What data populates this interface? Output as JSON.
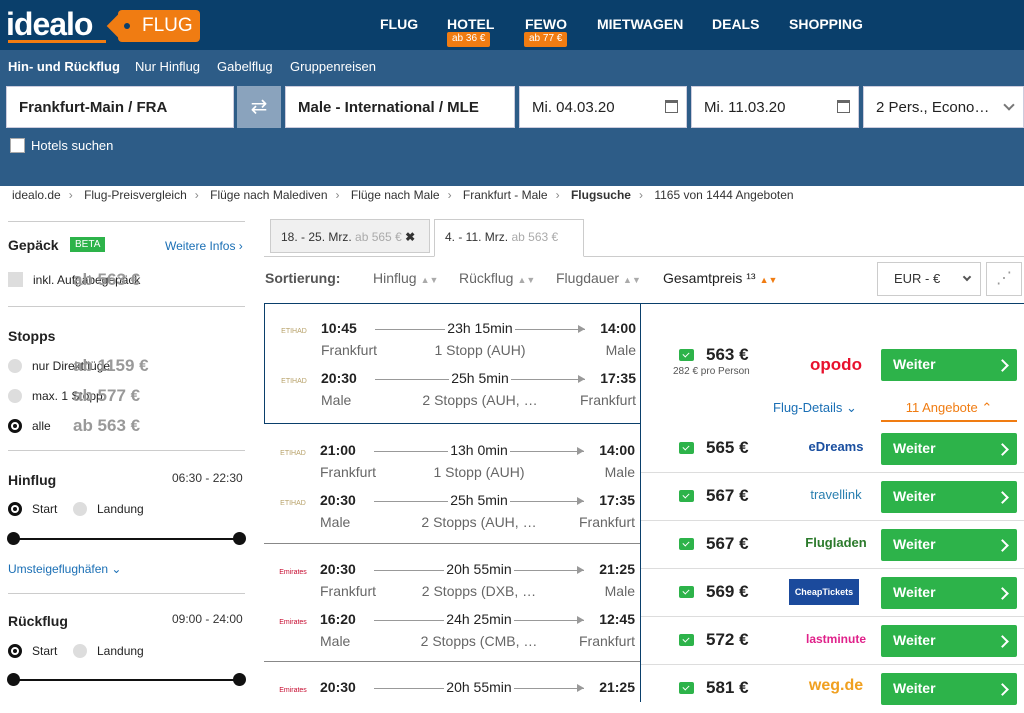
{
  "header": {
    "logo": "idealo",
    "logo_badge": "FLUG",
    "nav": [
      {
        "label": "FLUG"
      },
      {
        "label": "HOTEL",
        "badge": "ab 36 €"
      },
      {
        "label": "FEWO",
        "badge": "ab 77 €"
      },
      {
        "label": "MIETWAGEN"
      },
      {
        "label": "DEALS"
      },
      {
        "label": "SHOPPING"
      }
    ]
  },
  "search": {
    "tabs": [
      "Hin- und Rückflug",
      "Nur Hinflug",
      "Gabelflug",
      "Gruppenreisen"
    ],
    "from": "Frankfurt-Main / FRA",
    "to": "Male - International / MLE",
    "depart": "Mi. 04.03.20",
    "return": "Mi. 11.03.20",
    "passengers": "2 Pers., Econo…",
    "hotels": "Hotels suchen"
  },
  "breadcrumb": [
    "idealo.de",
    "Flug-Preisvergleich",
    "Flüge nach Malediven",
    "Flüge nach Male",
    "Frankfurt - Male",
    "Flugsuche",
    "1165 von 1444 Angeboten"
  ],
  "sidebar": {
    "gepaeck_title": "Gepäck",
    "beta": "BETA",
    "more_info": "Weitere Infos ›",
    "gepaeck_option": {
      "label": "inkl. Aufgabegepäck",
      "price": "ab 563 €"
    },
    "stopps_title": "Stopps",
    "stopps": [
      {
        "label": "nur Direktflüge",
        "price": "ab 1159 €"
      },
      {
        "label": "max. 1 Stopp",
        "price": "ab 577 €"
      },
      {
        "label": "alle",
        "price": "ab 563 €"
      }
    ],
    "hinflug_title": "Hinflug",
    "hinflug_range": "06:30 - 22:30",
    "start": "Start",
    "landung": "Landung",
    "umsteige": "Umsteigeflughäfen",
    "rueckflug_title": "Rückflug",
    "rueckflug_range": "09:00 - 24:00"
  },
  "date_tabs": [
    {
      "label": "18. - 25. Mrz.",
      "price": "ab 565 €"
    },
    {
      "label": "4. - 11. Mrz.",
      "price": "ab 563 €"
    }
  ],
  "sorting": {
    "label": "Sortierung:",
    "options": [
      "Hinflug",
      "Rückflug",
      "Flugdauer",
      "Gesamtpreis ¹³"
    ],
    "currency": "EUR - €"
  },
  "flights": [
    {
      "airline": "ETIHAD",
      "legs": [
        {
          "dep": "10:45",
          "from": "Frankfurt",
          "dur": "23h 15min",
          "stops": "1 Stopp (AUH)",
          "arr": "14:00",
          "to": "Male"
        },
        {
          "dep": "20:30",
          "from": "Male",
          "dur": "25h 5min",
          "stops": "2 Stopps (AUH, …",
          "arr": "17:35",
          "to": "Frankfurt"
        }
      ]
    },
    {
      "airline": "ETIHAD",
      "legs": [
        {
          "dep": "21:00",
          "from": "Frankfurt",
          "dur": "13h 0min",
          "stops": "1 Stopp (AUH)",
          "arr": "14:00",
          "to": "Male"
        },
        {
          "dep": "20:30",
          "from": "Male",
          "dur": "25h 5min",
          "stops": "2 Stopps (AUH, …",
          "arr": "17:35",
          "to": "Frankfurt"
        }
      ]
    },
    {
      "airline": "Emirates",
      "legs": [
        {
          "dep": "20:30",
          "from": "Frankfurt",
          "dur": "20h 55min",
          "stops": "2 Stopps (DXB, …",
          "arr": "21:25",
          "to": "Male"
        },
        {
          "dep": "16:20",
          "from": "Male",
          "dur": "24h 25min",
          "stops": "2 Stopps (CMB, …",
          "arr": "12:45",
          "to": "Frankfurt"
        }
      ]
    },
    {
      "airline": "Emirates",
      "legs": [
        {
          "dep": "20:30",
          "from": "",
          "dur": "20h 55min",
          "stops": "",
          "arr": "21:25",
          "to": ""
        }
      ]
    }
  ],
  "top_offer": {
    "price": "563 €",
    "per_person": "282 € pro Person",
    "provider": "opodo",
    "details": "Flug-Details",
    "angebote": "11 Angebote"
  },
  "offers": [
    {
      "price": "565 €",
      "provider": "eDreams"
    },
    {
      "price": "567 €",
      "provider": "travellink"
    },
    {
      "price": "567 €",
      "provider": "Flugladen"
    },
    {
      "price": "569 €",
      "provider": "CheapTickets"
    },
    {
      "price": "572 €",
      "provider": "lastminute"
    },
    {
      "price": "581 €",
      "provider": "weg.de"
    }
  ],
  "weiter_label": "Weiter"
}
